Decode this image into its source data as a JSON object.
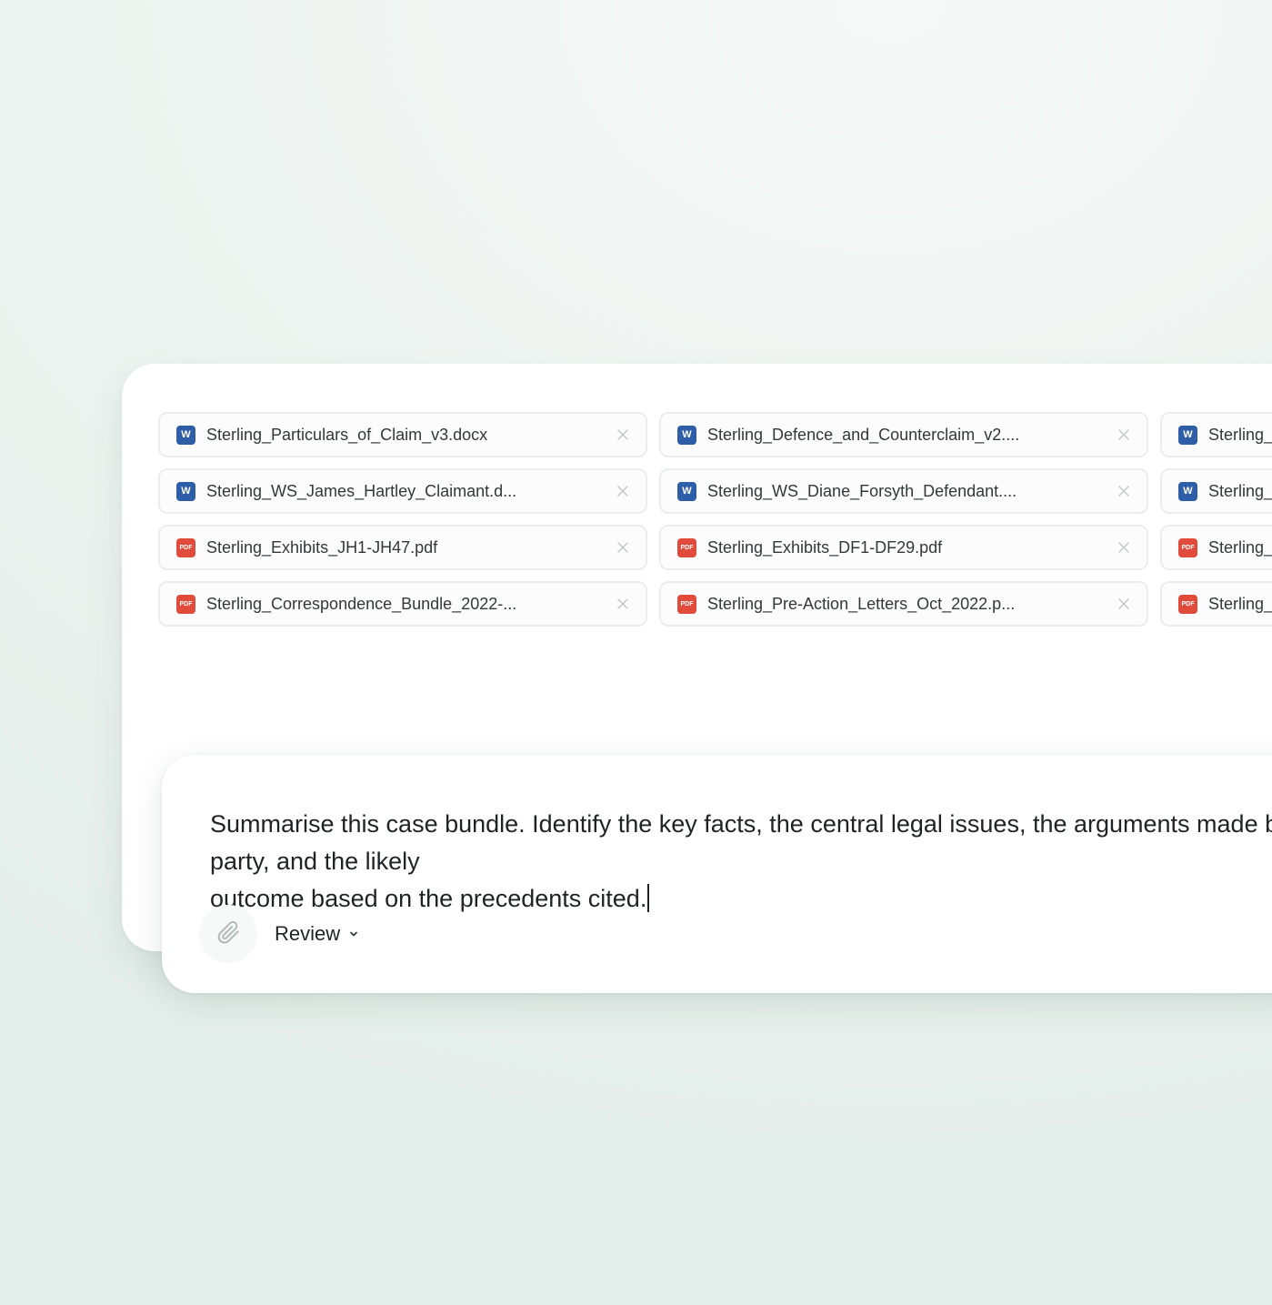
{
  "attachments": [
    {
      "name": "Sterling_Particulars_of_Claim_v3.docx",
      "type": "word",
      "icon": "word-doc-icon"
    },
    {
      "name": "Sterling_Defence_and_Counterclaim_v2....",
      "type": "word",
      "icon": "word-doc-icon"
    },
    {
      "name": "Sterling_",
      "type": "word",
      "icon": "word-doc-icon"
    },
    {
      "name": "Sterling_WS_James_Hartley_Claimant.d...",
      "type": "word",
      "icon": "word-doc-icon"
    },
    {
      "name": "Sterling_WS_Diane_Forsyth_Defendant....",
      "type": "word",
      "icon": "word-doc-icon"
    },
    {
      "name": "Sterling_",
      "type": "word",
      "icon": "word-doc-icon"
    },
    {
      "name": "Sterling_Exhibits_JH1-JH47.pdf",
      "type": "pdf",
      "icon": "pdf-doc-icon"
    },
    {
      "name": "Sterling_Exhibits_DF1-DF29.pdf",
      "type": "pdf",
      "icon": "pdf-doc-icon"
    },
    {
      "name": "Sterling_",
      "type": "pdf",
      "icon": "pdf-doc-icon"
    },
    {
      "name": "Sterling_Correspondence_Bundle_2022-...",
      "type": "pdf",
      "icon": "pdf-doc-icon"
    },
    {
      "name": "Sterling_Pre-Action_Letters_Oct_2022.p...",
      "type": "pdf",
      "icon": "pdf-doc-icon"
    },
    {
      "name": "Sterling_",
      "type": "pdf",
      "icon": "pdf-doc-icon"
    }
  ],
  "icon_labels": {
    "word": "W",
    "pdf": "PDF"
  },
  "prompt": {
    "text": "Summarise this case bundle. Identify the key facts, the central legal issues, the arguments made by each party, and the likely\noutcome based on the precedents cited."
  },
  "toolbar": {
    "attach_icon": "paperclip-icon",
    "mode_label": "Review",
    "mode_icon": "chevron-down-icon"
  },
  "colors": {
    "word_icon": "#2f5ea8",
    "pdf_icon": "#e14b3b",
    "background": "#e9f1ee"
  }
}
